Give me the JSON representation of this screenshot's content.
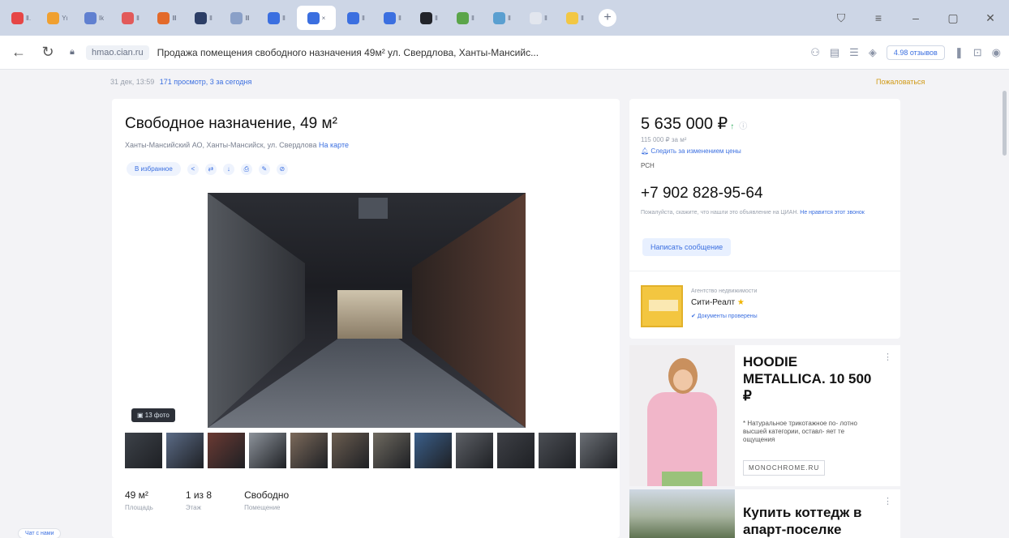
{
  "browser": {
    "tabs": [
      {
        "label": "Ⅱ.",
        "color": "#e64646"
      },
      {
        "label": "Yı",
        "color": "#f0a030"
      },
      {
        "label": "Ⅰk",
        "color": "#6080d0"
      },
      {
        "label": "Ⅱ",
        "color": "#e25a5a"
      },
      {
        "label": "Ⅲ",
        "color": "#e36a2a"
      },
      {
        "label": "Ⅱ",
        "color": "#2c3e66"
      },
      {
        "label": "Ⅲ",
        "color": "#8aa0c8"
      },
      {
        "label": "Ⅱ",
        "color": "#3b6fe0"
      },
      {
        "label": "×",
        "color": "#3b6fe0",
        "active": true
      },
      {
        "label": "Ⅱ",
        "color": "#3b6fe0"
      },
      {
        "label": "Ⅱ",
        "color": "#3b6fe0"
      },
      {
        "label": "Ⅱ",
        "color": "#22242a"
      },
      {
        "label": "Ⅱ",
        "color": "#5ba54a"
      },
      {
        "label": "Ⅱ",
        "color": "#5a9fd0"
      },
      {
        "label": "Ⅱ",
        "color": "#e2e6ee"
      },
      {
        "label": "Ⅱ",
        "color": "#f2c744"
      }
    ],
    "domain": "hmao.cian.ru",
    "page_title": "Продажа помещения свободного назначения 49м² ул. Свердлова, Ханты-Мансийс...",
    "reviews": "4.98 отзывов"
  },
  "meta": {
    "date": "31 дек, 13:59",
    "views": "171 просмотр, 3 за сегодня",
    "complain": "Пожаловаться"
  },
  "listing": {
    "title": "Свободное назначение, 49 м²",
    "address": "Ханты-Мансийский АО, Ханты-Мансийск, ул. Свердлова",
    "map_link": "На карте",
    "favorite": "В избранное",
    "photo_count": "13 фото",
    "facts": [
      {
        "value": "49 м²",
        "label": "Площадь"
      },
      {
        "value": "1 из 8",
        "label": "Этаж"
      },
      {
        "value": "Свободно",
        "label": "Помещение"
      }
    ]
  },
  "offer": {
    "price": "5 635 000 ₽",
    "trend": "↑",
    "info": "ⓘ",
    "price_per_m": "115 000 ₽ за м²",
    "follow": "Следить за изменением цены",
    "owner": "РСН",
    "phone": "+7 902 828-95-64",
    "phone_note": "Пожалуйста, скажите, что нашли это объявление на ЦИАН. ",
    "phone_note_link": "Не нравится этот звонок",
    "write_button": "Написать сообщение",
    "agency_type": "Агентство недвижимости",
    "agency_name": "Сити-Реалт",
    "agency_docs": "Документы проверены"
  },
  "ads": {
    "ad1_title": "HOODIE METALLICA. 10 500 ₽",
    "ad1_text": "* Натуральное трикотажное по- лотно высшей категории, оставл- яет те ощущения",
    "ad1_domain": "MONOCHROME.RU",
    "ad2_title": "Купить коттедж в апарт-поселке"
  },
  "chat": "Чат с нами",
  "thumbs": [
    "#3d4249",
    "#5b6b86",
    "#6b3a33",
    "#8d939b",
    "#7c6a5b",
    "#6b5d50",
    "#6f6a60",
    "#3b5f8a",
    "#5d6066",
    "#3e4046",
    "#4b4e54",
    "#6b6f75"
  ],
  "colors": {
    "accent": "#3b6fe0",
    "price_up": "#2aa85a",
    "favorite_bg": "#eef3fd"
  }
}
